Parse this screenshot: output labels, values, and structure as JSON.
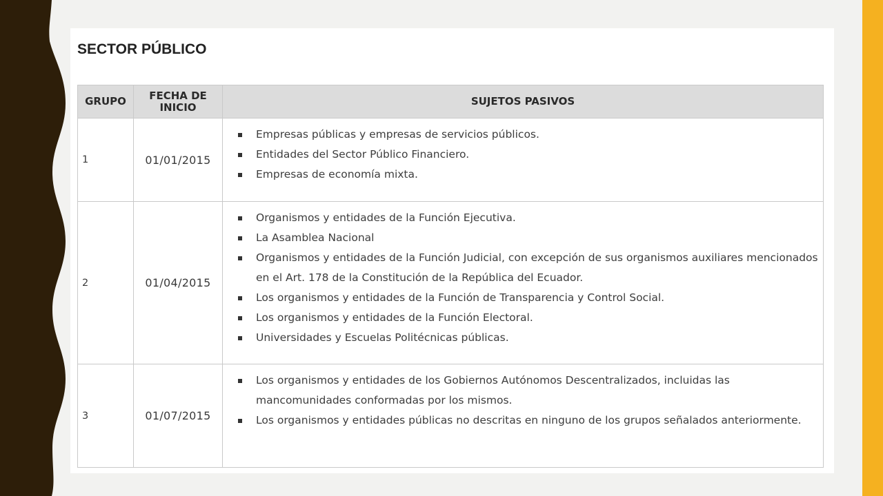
{
  "section_title": "SECTOR PÚBLICO",
  "table": {
    "headers": {
      "grupo": "GRUPO",
      "fecha_line1": "FECHA DE",
      "fecha_line2": "INICIO",
      "sujetos": "SUJETOS PASIVOS"
    },
    "rows": [
      {
        "grupo": "1",
        "fecha": "01/01/2015",
        "items": [
          "Empresas públicas y empresas de servicios públicos.",
          "Entidades del Sector Público Financiero.",
          "Empresas de economía mixta."
        ]
      },
      {
        "grupo": "2",
        "fecha": "01/04/2015",
        "items": [
          "Organismos y entidades de la Función Ejecutiva.",
          "La Asamblea Nacional",
          "Organismos y entidades de la Función Judicial, con excepción de sus organismos auxiliares mencionados en el Art. 178 de la Constitución de la República del Ecuador.",
          "Los organismos y entidades de la Función de Transparencia y Control Social.",
          "Los organismos y entidades de la Función Electoral.",
          "Universidades y Escuelas Politécnicas públicas."
        ]
      },
      {
        "grupo": "3",
        "fecha": "01/07/2015",
        "items": [
          "Los organismos y entidades de los Gobiernos Autónomos Descentralizados, incluidas las mancomunidades conformadas por los mismos.",
          "Los organismos y entidades públicas no descritas en ninguno de los grupos señalados anteriormente."
        ]
      }
    ]
  },
  "colors": {
    "left_band": "#2d1e09",
    "right_accent": "#f5b120",
    "header_bg": "#dcdcdc"
  }
}
